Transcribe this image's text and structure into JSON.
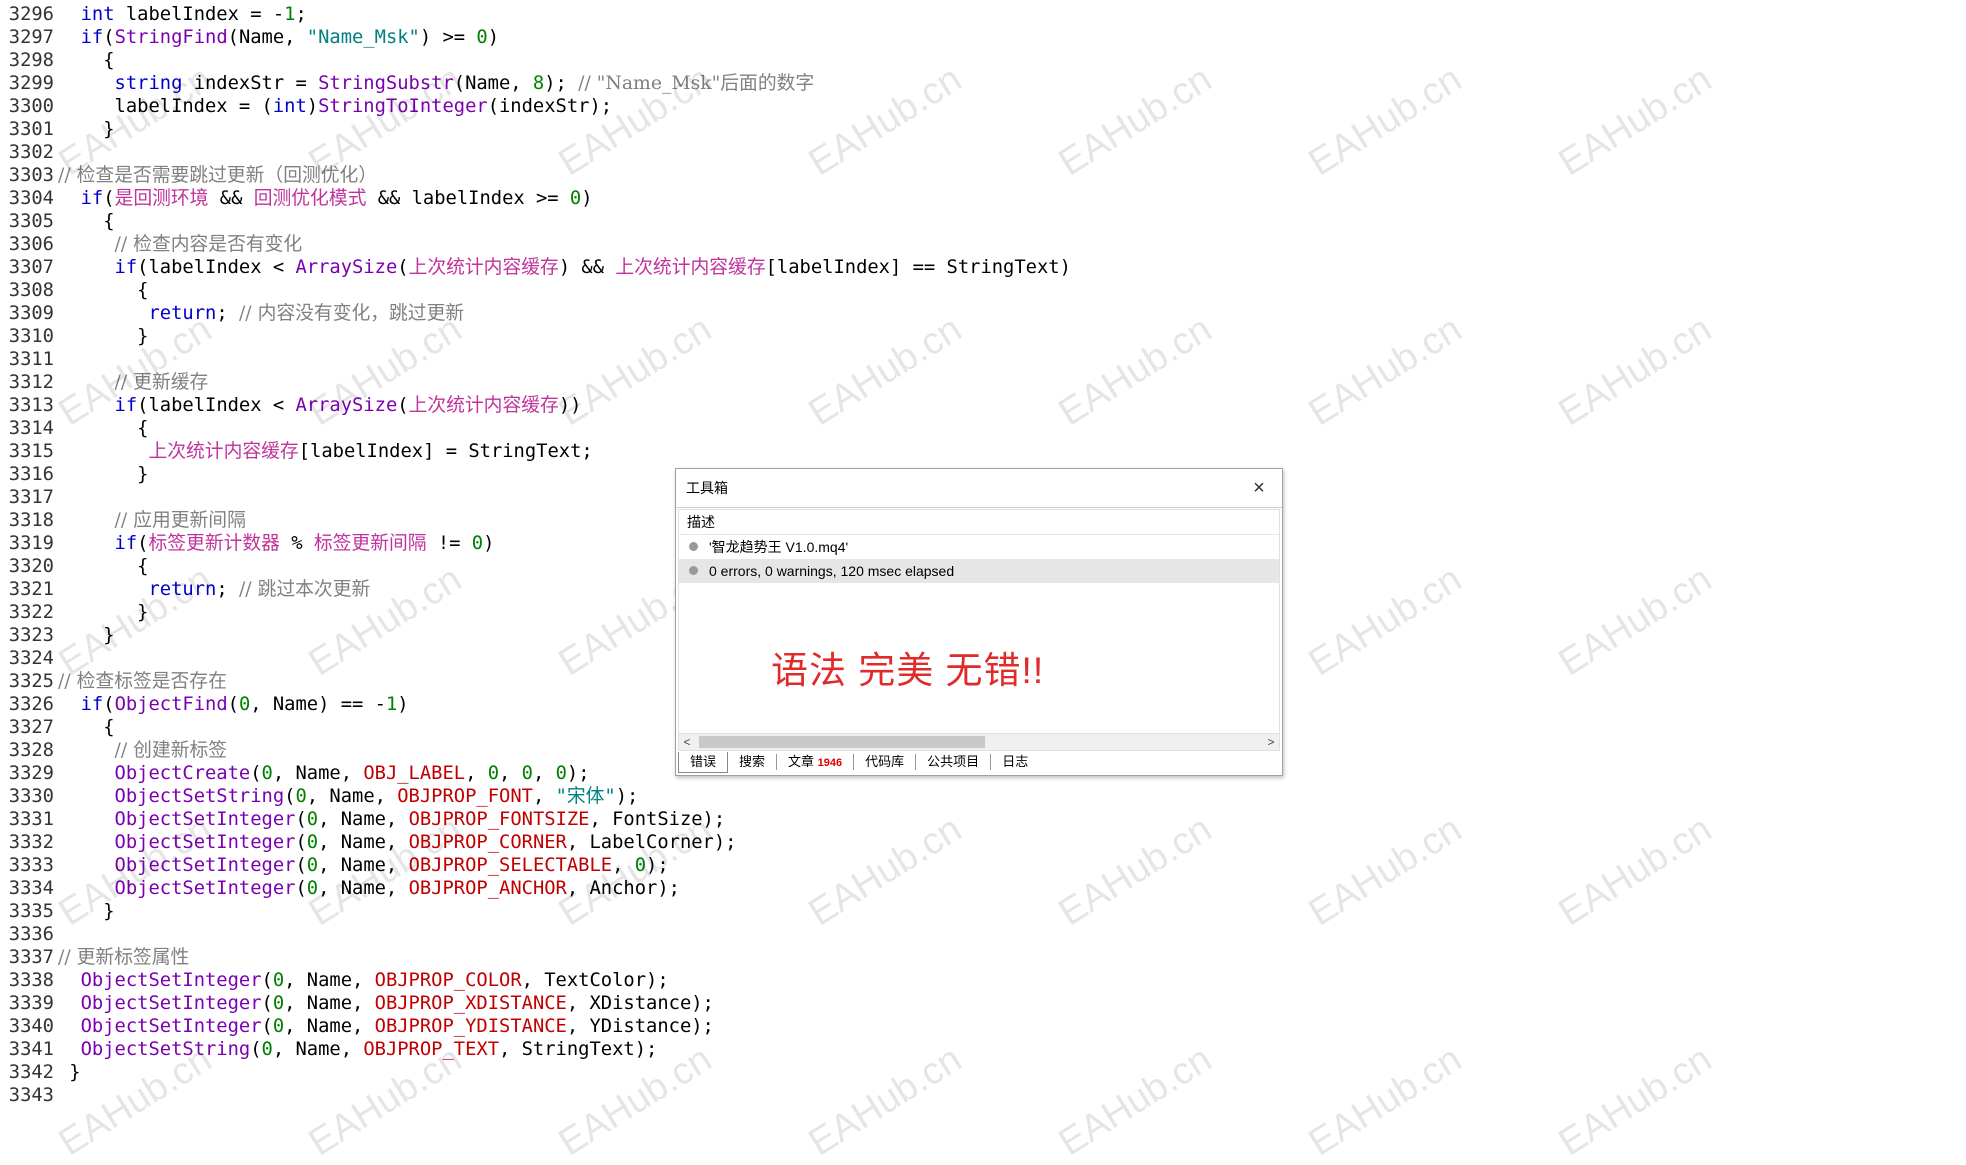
{
  "code_lines": [
    {
      "n": "3296",
      "html": "  <span class='kw'>int</span> labelIndex = -<span class='num'>1</span>;"
    },
    {
      "n": "3297",
      "html": "  <span class='kw'>if</span>(<span class='fn'>StringFind</span>(Name, <span class='str'>\"Name_Msk\"</span>) >= <span class='num'>0</span>)"
    },
    {
      "n": "3298",
      "html": "    {"
    },
    {
      "n": "3299",
      "html": "     <span class='kw'>string</span> indexStr = <span class='fn'>StringSubstr</span>(Name, <span class='num'>8</span>); <span class='cm'>// \"Name_Msk\"后面的数字</span>"
    },
    {
      "n": "3300",
      "html": "     labelIndex = (<span class='kw'>int</span>)<span class='fn'>StringToInteger</span>(indexStr);"
    },
    {
      "n": "3301",
      "html": "    }"
    },
    {
      "n": "3302",
      "html": ""
    },
    {
      "n": "3303",
      "html": "<span class='cm'>// 检查是否需要跳过更新（回测优化）</span>"
    },
    {
      "n": "3304",
      "html": "  <span class='kw'>if</span>(<span class='cn'>是回测环境</span> && <span class='cn'>回测优化模式</span> && labelIndex >= <span class='num'>0</span>)"
    },
    {
      "n": "3305",
      "html": "    {"
    },
    {
      "n": "3306",
      "html": "     <span class='cm'>// 检查内容是否有变化</span>"
    },
    {
      "n": "3307",
      "html": "     <span class='kw'>if</span>(labelIndex < <span class='fn'>ArraySize</span>(<span class='cn'>上次统计内容缓存</span>) && <span class='cn'>上次统计内容缓存</span>[labelIndex] == StringText)"
    },
    {
      "n": "3308",
      "html": "       {"
    },
    {
      "n": "3309",
      "html": "        <span class='kw'>return</span>; <span class='cm'>// 内容没有变化，跳过更新</span>"
    },
    {
      "n": "3310",
      "html": "       }"
    },
    {
      "n": "3311",
      "html": ""
    },
    {
      "n": "3312",
      "html": "     <span class='cm'>// 更新缓存</span>"
    },
    {
      "n": "3313",
      "html": "     <span class='kw'>if</span>(labelIndex < <span class='fn'>ArraySize</span>(<span class='cn'>上次统计内容缓存</span>))"
    },
    {
      "n": "3314",
      "html": "       {"
    },
    {
      "n": "3315",
      "html": "        <span class='cn'>上次统计内容缓存</span>[labelIndex] = StringText;"
    },
    {
      "n": "3316",
      "html": "       }"
    },
    {
      "n": "3317",
      "html": ""
    },
    {
      "n": "3318",
      "html": "     <span class='cm'>// 应用更新间隔</span>"
    },
    {
      "n": "3319",
      "html": "     <span class='kw'>if</span>(<span class='cn'>标签更新计数器</span> % <span class='cn'>标签更新间隔</span> != <span class='num'>0</span>)"
    },
    {
      "n": "3320",
      "html": "       {"
    },
    {
      "n": "3321",
      "html": "        <span class='kw'>return</span>; <span class='cm'>// 跳过本次更新</span>"
    },
    {
      "n": "3322",
      "html": "       }"
    },
    {
      "n": "3323",
      "html": "    }"
    },
    {
      "n": "3324",
      "html": ""
    },
    {
      "n": "3325",
      "html": "<span class='cm'>// 检查标签是否存在</span>"
    },
    {
      "n": "3326",
      "html": "  <span class='kw'>if</span>(<span class='fn'>ObjectFind</span>(<span class='num'>0</span>, Name) == -<span class='num'>1</span>)"
    },
    {
      "n": "3327",
      "html": "    {"
    },
    {
      "n": "3328",
      "html": "     <span class='cm'>// 创建新标签</span>"
    },
    {
      "n": "3329",
      "html": "     <span class='fn'>ObjectCreate</span>(<span class='num'>0</span>, Name, <span class='const'>OBJ_LABEL</span>, <span class='num'>0</span>, <span class='num'>0</span>, <span class='num'>0</span>);"
    },
    {
      "n": "3330",
      "html": "     <span class='fn'>ObjectSetString</span>(<span class='num'>0</span>, Name, <span class='const'>OBJPROP_FONT</span>, <span class='str'>\"宋体\"</span>);"
    },
    {
      "n": "3331",
      "html": "     <span class='fn'>ObjectSetInteger</span>(<span class='num'>0</span>, Name, <span class='const'>OBJPROP_FONTSIZE</span>, FontSize);"
    },
    {
      "n": "3332",
      "html": "     <span class='fn'>ObjectSetInteger</span>(<span class='num'>0</span>, Name, <span class='const'>OBJPROP_CORNER</span>, LabelCorner);"
    },
    {
      "n": "3333",
      "html": "     <span class='fn'>ObjectSetInteger</span>(<span class='num'>0</span>, Name, <span class='const'>OBJPROP_SELECTABLE</span>, <span class='num'>0</span>);"
    },
    {
      "n": "3334",
      "html": "     <span class='fn'>ObjectSetInteger</span>(<span class='num'>0</span>, Name, <span class='const'>OBJPROP_ANCHOR</span>, Anchor);"
    },
    {
      "n": "3335",
      "html": "    }"
    },
    {
      "n": "3336",
      "html": ""
    },
    {
      "n": "3337",
      "html": "<span class='cm'>// 更新标签属性</span>"
    },
    {
      "n": "3338",
      "html": "  <span class='fn'>ObjectSetInteger</span>(<span class='num'>0</span>, Name, <span class='const'>OBJPROP_COLOR</span>, TextColor);"
    },
    {
      "n": "3339",
      "html": "  <span class='fn'>ObjectSetInteger</span>(<span class='num'>0</span>, Name, <span class='const'>OBJPROP_XDISTANCE</span>, XDistance);"
    },
    {
      "n": "3340",
      "html": "  <span class='fn'>ObjectSetInteger</span>(<span class='num'>0</span>, Name, <span class='const'>OBJPROP_YDISTANCE</span>, YDistance);"
    },
    {
      "n": "3341",
      "html": "  <span class='fn'>ObjectSetString</span>(<span class='num'>0</span>, Name, <span class='const'>OBJPROP_TEXT</span>, StringText);"
    },
    {
      "n": "3342",
      "html": " }"
    },
    {
      "n": "3343",
      "html": ""
    }
  ],
  "watermark": "EAHub.cn",
  "toolbox": {
    "title": "工具箱",
    "close_icon": "×",
    "header": "描述",
    "rows": [
      "'智龙趋势王 V1.0.mq4'",
      "0 errors, 0 warnings, 120 msec elapsed"
    ],
    "message": "语法 完美 无错!!",
    "scroll_left": "<",
    "scroll_right": ">",
    "tabs": [
      {
        "label": "错误",
        "badge": ""
      },
      {
        "label": "搜索",
        "badge": ""
      },
      {
        "label": "文章",
        "badge": "1946"
      },
      {
        "label": "代码库",
        "badge": ""
      },
      {
        "label": "公共项目",
        "badge": ""
      },
      {
        "label": "日志",
        "badge": ""
      }
    ]
  },
  "colors": {
    "keyword": "#0000cc",
    "function": "#7a00b0",
    "string": "#008080",
    "number": "#008000",
    "chinese_identifier": "#c0339b",
    "comment": "#808080",
    "constant": "#c00000",
    "message": "#e02b2b"
  }
}
